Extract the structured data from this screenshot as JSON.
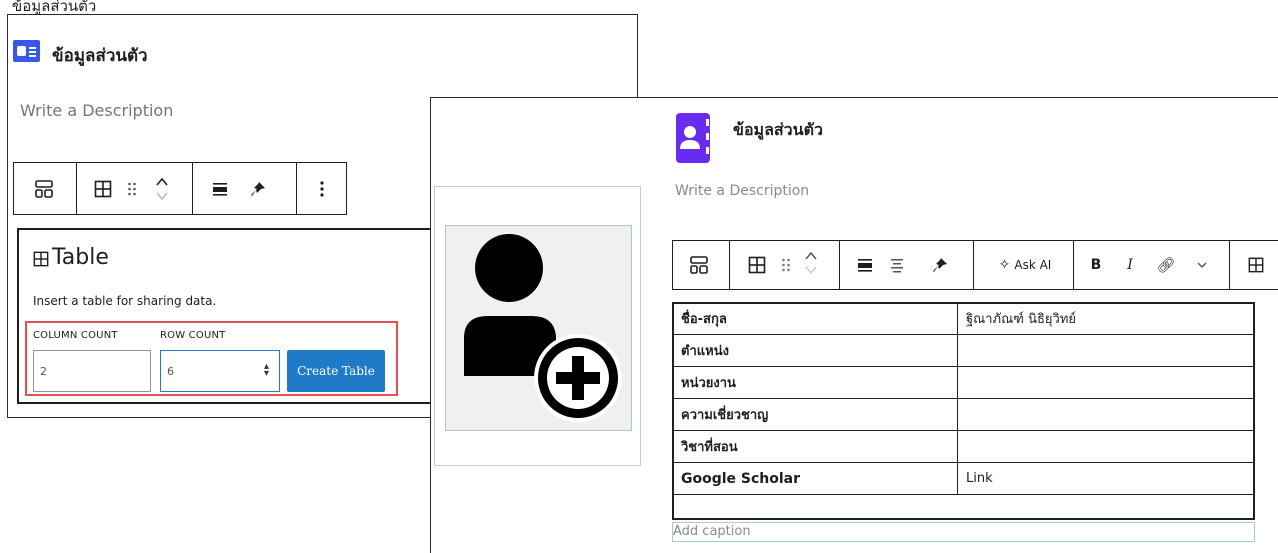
{
  "panel_left": {
    "block_title": "ข้อมูลส่วนตัว",
    "description_placeholder": "Write a Description",
    "table_block": {
      "title": "Table",
      "instructions": "Insert a table for sharing data.",
      "column_count_label": "COLUMN COUNT",
      "row_count_label": "ROW COUNT",
      "column_count_value": "2",
      "row_count_value": "6",
      "create_button": "Create Table"
    }
  },
  "panel_right": {
    "block_title": "ข้อมูลส่วนตัว",
    "description_placeholder": "Write a Description",
    "toolbar": {
      "ask_ai_label": "Ask AI",
      "bold_label": "B",
      "italic_label": "I"
    },
    "table_rows": [
      {
        "label": "ชื่อ-สกุล",
        "value": "ฐิณาภัณฑ์ นิธิยุวิทย์"
      },
      {
        "label": "ตำแหน่ง",
        "value": ""
      },
      {
        "label": "หน่วยงาน",
        "value": ""
      },
      {
        "label": "ความเชี่ยวชาญ",
        "value": ""
      },
      {
        "label": "วิชาที่สอน",
        "value": ""
      },
      {
        "label": "Google Scholar",
        "value": "Link"
      }
    ],
    "caption_placeholder": "Add caption"
  },
  "top_strip_text": "ข้อมูลส่วนตัว",
  "colors": {
    "accent_blue": "#3858e9",
    "accent_purple": "#6a2bf0",
    "create_button": "#1f7ac8",
    "highlight_red": "#e65054"
  }
}
